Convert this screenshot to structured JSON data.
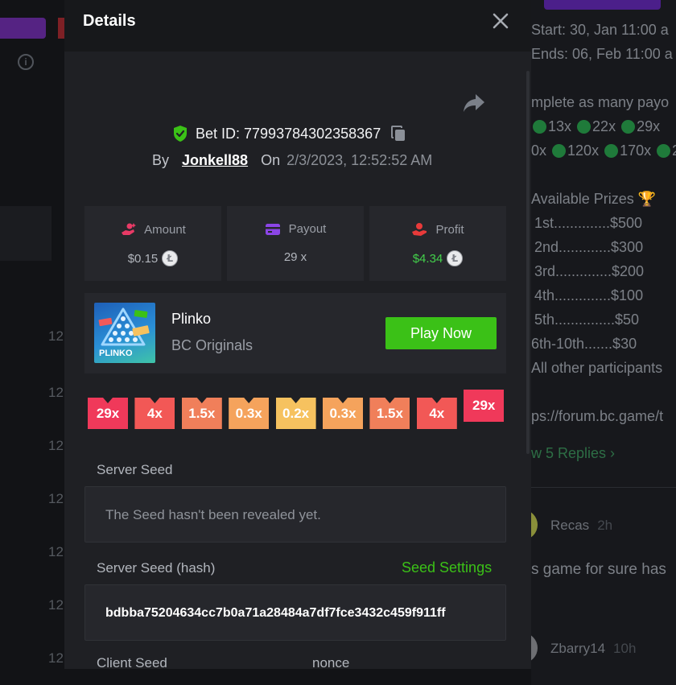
{
  "background": {
    "info_icon_text": "i",
    "row_numbers": [
      "12",
      "12",
      "12",
      "12",
      "12",
      "12",
      "12"
    ],
    "contest": {
      "start": "Start: 30, Jan 11:00 a",
      "ends": "Ends: 06, Feb 11:00 a",
      "description": "mplete as many payo",
      "multipliers_row1": [
        "13x",
        "22x",
        "29x"
      ],
      "multipliers_row2_prefix": "0x",
      "multipliers_row2": [
        "120x",
        "170x",
        "2"
      ],
      "prizes_title": "Available Prizes 🏆",
      "prizes": [
        "1st..............$500",
        "2nd.............$300",
        "3rd..............$200",
        "4th..............$100",
        "5th...............$50",
        "6th-10th.......$30"
      ],
      "other": "All other participants",
      "link": "ps://forum.bc.game/t",
      "replies": "w 5 Replies"
    },
    "comments": [
      {
        "user": "Recas",
        "time": "2h"
      },
      {
        "user": "Zbarry14",
        "time": "10h"
      }
    ],
    "comment_text": "s game for sure has"
  },
  "modal": {
    "title": "Details",
    "bet_id": "Bet ID: 77993784302358367",
    "by_label": "By",
    "username": "Jonkell88",
    "on_label": "On",
    "date": "2/3/2023, 12:52:52 AM",
    "stats": {
      "amount": {
        "label": "Amount",
        "value": "$0.15"
      },
      "payout": {
        "label": "Payout",
        "value": "29 x"
      },
      "profit": {
        "label": "Profit",
        "value": "$4.34"
      }
    },
    "game": {
      "name": "Plinko",
      "provider": "BC Originals",
      "thumb_label": "PLINKO",
      "play_label": "Play Now"
    },
    "multipliers": [
      {
        "label": "29x",
        "color": "#f0395a"
      },
      {
        "label": "4x",
        "color": "#f25856"
      },
      {
        "label": "1.5x",
        "color": "#f07f5a"
      },
      {
        "label": "0.3x",
        "color": "#f5a35c"
      },
      {
        "label": "0.2x",
        "color": "#f6c25f"
      },
      {
        "label": "0.3x",
        "color": "#f5a35c"
      },
      {
        "label": "1.5x",
        "color": "#f07f5a"
      },
      {
        "label": "4x",
        "color": "#f25856"
      },
      {
        "label": "29x",
        "color": "#f0395a"
      }
    ],
    "hit_slot_index": 8,
    "server_seed_label": "Server Seed",
    "server_seed_value": "The Seed hasn't been revealed yet.",
    "server_seed_hash_label": "Server Seed (hash)",
    "seed_settings": "Seed Settings",
    "server_seed_hash": "bdbba75204634cc7b0a71a28484a7df7fce3432c459f911ff",
    "client_seed_label": "Client Seed",
    "nonce_label": "nonce"
  },
  "colors": {
    "accent_green": "#3bc117",
    "profit_green": "#43d04b",
    "modal_bg": "#1f2024",
    "card_bg": "#26272c"
  }
}
